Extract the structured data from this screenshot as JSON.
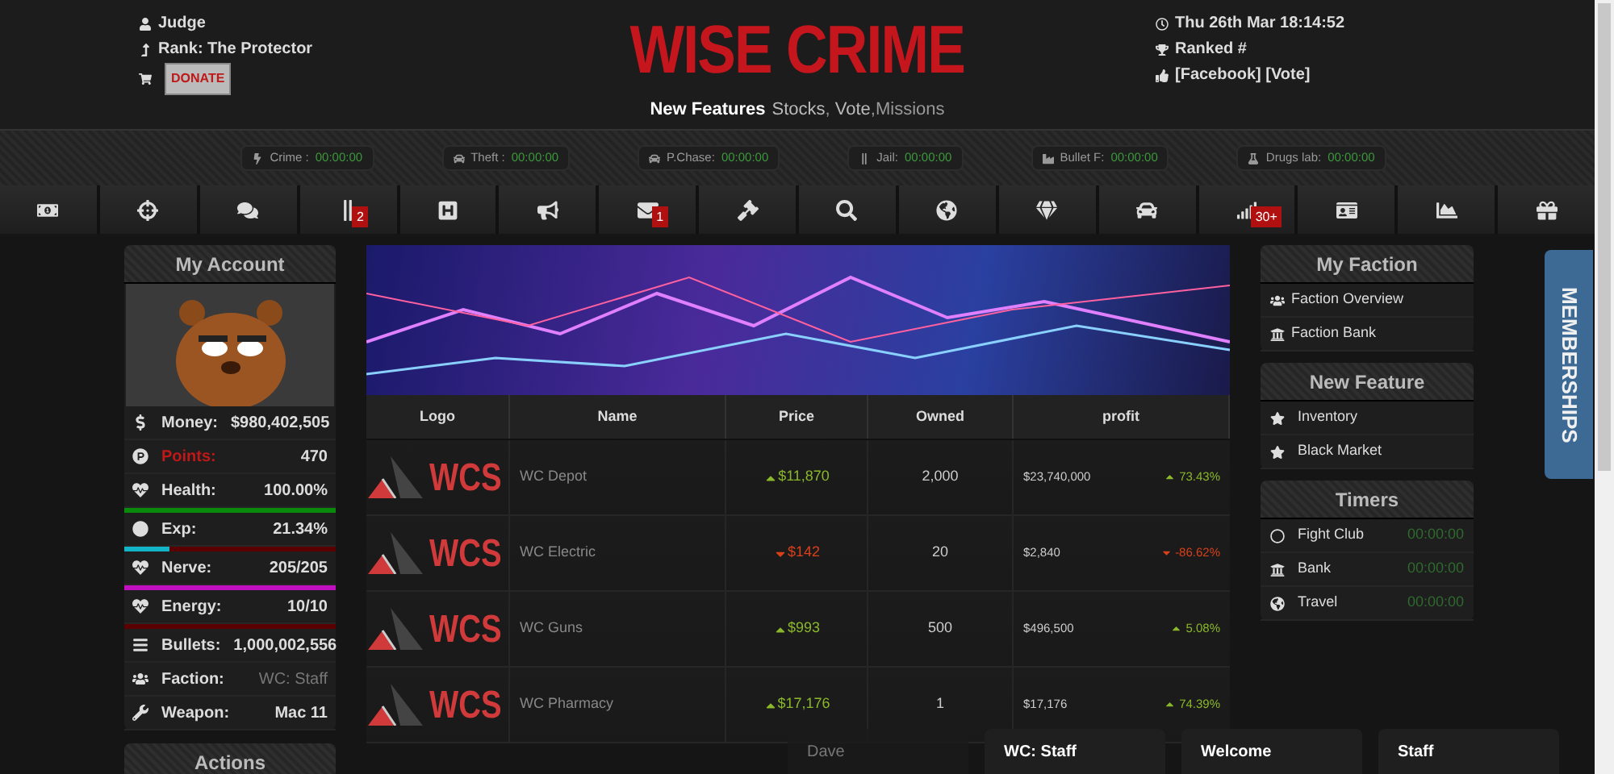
{
  "header": {
    "user": "Judge",
    "rank": "Rank: The Protector",
    "donate": "DONATE",
    "title": "WISE CRIME",
    "subtitle": "New Features",
    "feature_links": [
      "Stocks",
      ", ",
      "Vote",
      ",Missions"
    ],
    "datetime": "Thu 26th Mar 18:14:52",
    "ranked": "Ranked #",
    "social": "[Facebook] [Vote]"
  },
  "timers_bar": [
    {
      "label": "Crime :",
      "time": "00:00:00"
    },
    {
      "label": "Theft :",
      "time": "00:00:00"
    },
    {
      "label": "P.Chase:",
      "time": "00:00:00"
    },
    {
      "label": "Jail:",
      "time": "00:00:00"
    },
    {
      "label": "Bullet F:",
      "time": "00:00:00"
    },
    {
      "label": "Drugs lab:",
      "time": "00:00:00"
    }
  ],
  "nav": [
    {
      "kind": "money"
    },
    {
      "kind": "crosshair"
    },
    {
      "kind": "chat"
    },
    {
      "kind": "bars",
      "badge": "2"
    },
    {
      "kind": "hospital"
    },
    {
      "kind": "megaphone"
    },
    {
      "kind": "mail",
      "badge": "1"
    },
    {
      "kind": "gavel"
    },
    {
      "kind": "search"
    },
    {
      "kind": "globe"
    },
    {
      "kind": "diamond"
    },
    {
      "kind": "car"
    },
    {
      "kind": "signal",
      "badge": "30+"
    },
    {
      "kind": "card"
    },
    {
      "kind": "chart"
    },
    {
      "kind": "gift"
    }
  ],
  "account": {
    "title": "My Account",
    "stats": [
      {
        "label": "Money:",
        "value": "$980,402,505",
        "alert": false,
        "muted": false
      },
      {
        "label": "Points:",
        "value": "470",
        "alert": true,
        "muted": false
      },
      {
        "label": "Health:",
        "value": "100.00%",
        "alert": false,
        "muted": false,
        "bar": {
          "level": 1,
          "color": "#0a8a0a"
        }
      },
      {
        "label": "Exp:",
        "value": "21.34%",
        "alert": false,
        "muted": false,
        "bar": {
          "level": 0.21,
          "color": "#12b5c8"
        }
      },
      {
        "label": "Nerve:",
        "value": "205/205",
        "alert": false,
        "muted": false,
        "bar": {
          "level": 1,
          "color": "#c010c0"
        }
      },
      {
        "label": "Energy:",
        "value": "10/10",
        "alert": false,
        "muted": false,
        "bar": {
          "level": 1,
          "color": "#5a0000"
        }
      },
      {
        "label": "Bullets:",
        "value": "1,000,002,556",
        "alert": false,
        "muted": false
      },
      {
        "label": "Faction:",
        "value": "WC: Staff",
        "alert": false,
        "muted": true
      },
      {
        "label": "Weapon:",
        "value": "Mac 11",
        "alert": false,
        "muted": false
      }
    ],
    "next_panel": "Actions"
  },
  "stocks": {
    "columns": [
      "Logo",
      "Name",
      "Price",
      "Owned",
      "profit"
    ],
    "rows": [
      {
        "logo": "WCS",
        "name": "WC Depot",
        "price": "$11,870",
        "rising": true,
        "owned": "2,000",
        "value": "$23,740,000",
        "change": "73.43%"
      },
      {
        "logo": "WCS",
        "name": "WC Electric",
        "price": "$142",
        "rising": false,
        "owned": "20",
        "value": "$2,840",
        "change": "-86.62%"
      },
      {
        "logo": "WCS",
        "name": "WC Guns",
        "price": "$993",
        "rising": true,
        "owned": "500",
        "value": "$496,500",
        "change": "5.08%"
      },
      {
        "logo": "WCS",
        "name": "WC Pharmacy",
        "price": "$17,176",
        "rising": true,
        "owned": "1",
        "value": "$17,176",
        "change": "74.39%"
      }
    ]
  },
  "faction": {
    "title": "My Faction",
    "items": [
      "Faction Overview",
      "Faction Bank"
    ]
  },
  "new_feature": {
    "title": "New Feature",
    "items": [
      "Inventory",
      "Black Market"
    ]
  },
  "timers": {
    "title": "Timers",
    "items": [
      {
        "label": "Fight Club",
        "time": "00:00:00"
      },
      {
        "label": "Bank",
        "time": "00:00:00"
      },
      {
        "label": "Travel",
        "time": "00:00:00"
      }
    ]
  },
  "memberships": "MEMBERSHIPS",
  "chat_tabs": [
    {
      "label": "Dave",
      "selected": false
    },
    {
      "label": "WC: Staff",
      "selected": true
    },
    {
      "label": "Welcome",
      "selected": true
    },
    {
      "label": "Staff",
      "selected": true
    }
  ]
}
